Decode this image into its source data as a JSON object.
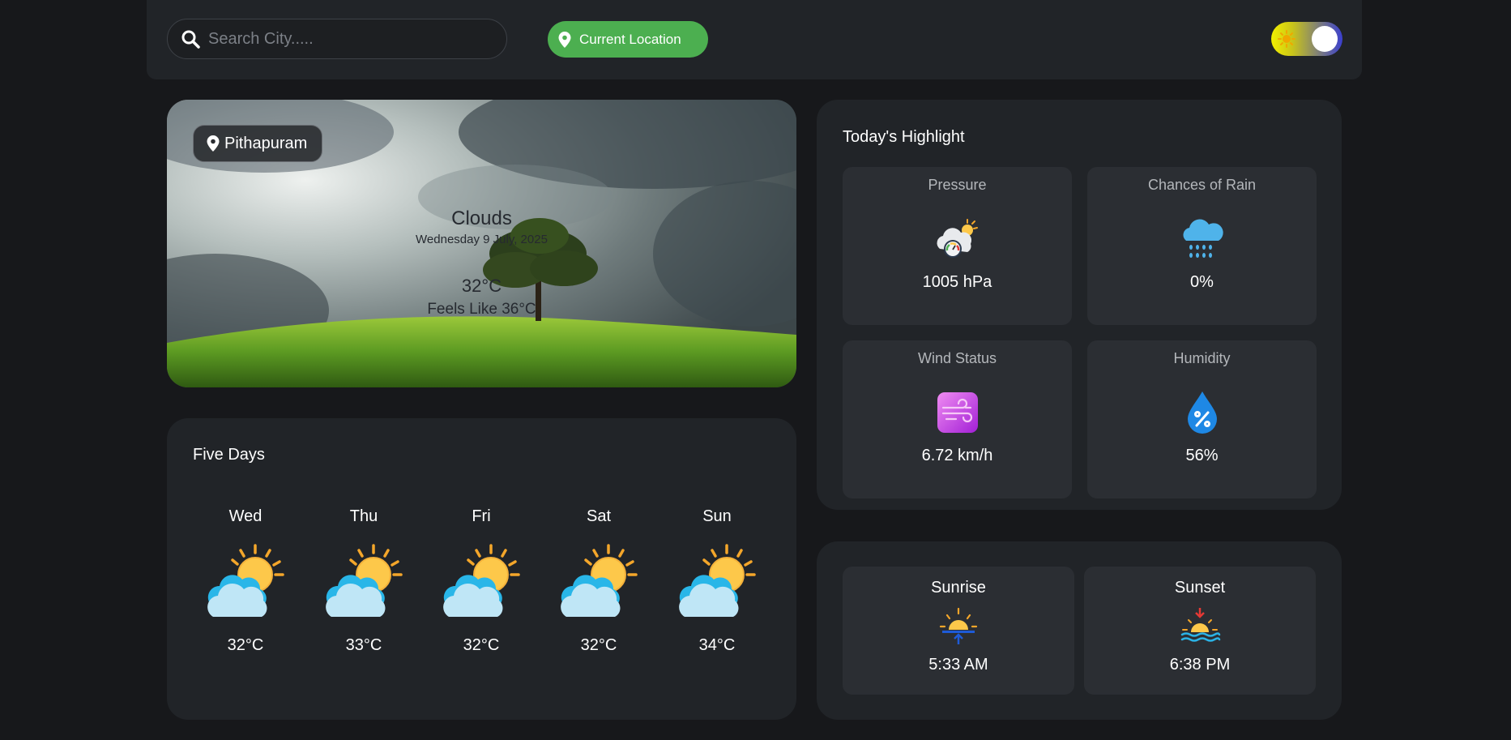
{
  "search": {
    "placeholder": "Search City....."
  },
  "location_button": {
    "label": "Current Location"
  },
  "theme_toggle": {
    "state": "dark"
  },
  "current": {
    "city": "Pithapuram",
    "condition": "Clouds",
    "date": "Wednesday 9 July, 2025",
    "temperature": "32°C",
    "feels_like": "Feels Like 36°C"
  },
  "forecast": {
    "title": "Five Days",
    "days": [
      {
        "day": "Wed",
        "temp": "32°C",
        "icon": "sun-cloud-icon"
      },
      {
        "day": "Thu",
        "temp": "33°C",
        "icon": "sun-cloud-icon"
      },
      {
        "day": "Fri",
        "temp": "32°C",
        "icon": "sun-cloud-icon"
      },
      {
        "day": "Sat",
        "temp": "32°C",
        "icon": "sun-cloud-icon"
      },
      {
        "day": "Sun",
        "temp": "34°C",
        "icon": "sun-cloud-icon"
      }
    ]
  },
  "highlights": {
    "title": "Today's Highlight",
    "pressure": {
      "label": "Pressure",
      "value": "1005 hPa",
      "icon": "pressure-icon"
    },
    "rain": {
      "label": "Chances of Rain",
      "value": "0%",
      "icon": "rain-cloud-icon"
    },
    "wind": {
      "label": "Wind Status",
      "value": "6.72 km/h",
      "icon": "wind-icon"
    },
    "humidity": {
      "label": "Humidity",
      "value": "56%",
      "icon": "humidity-drop-icon"
    }
  },
  "sun": {
    "sunrise": {
      "label": "Sunrise",
      "value": "5:33 AM",
      "icon": "sunrise-icon"
    },
    "sunset": {
      "label": "Sunset",
      "value": "6:38 PM",
      "icon": "sunset-icon"
    }
  },
  "colors": {
    "background": "#17181b",
    "card": "#212428",
    "tile": "#2b2e33",
    "accent_green": "#4caf50"
  }
}
